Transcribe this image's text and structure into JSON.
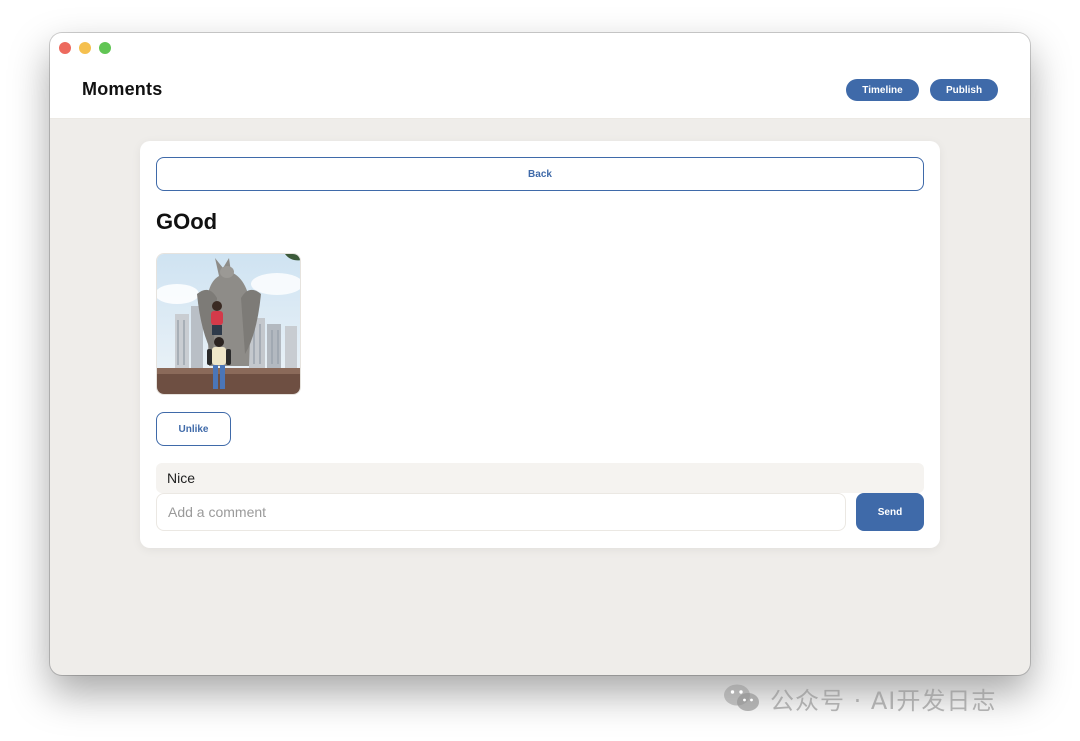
{
  "window": {
    "traffic_lights": [
      "close",
      "minimize",
      "zoom"
    ]
  },
  "header": {
    "title": "Moments",
    "timeline_label": "Timeline",
    "publish_label": "Publish"
  },
  "post": {
    "back_label": "Back",
    "title": "GOod",
    "like_label": "Unlike",
    "comments": [
      {
        "text": "Nice"
      }
    ],
    "comment_input": {
      "placeholder": "Add a comment",
      "value": ""
    },
    "send_label": "Send"
  },
  "watermark": {
    "text": "公众号 · AI开发日志",
    "icon": "wechat-icon"
  },
  "colors": {
    "accent": "#3f6aa9",
    "window_bg": "#efedea",
    "card_bg": "#ffffff",
    "comment_bg": "#f5f3f0"
  }
}
